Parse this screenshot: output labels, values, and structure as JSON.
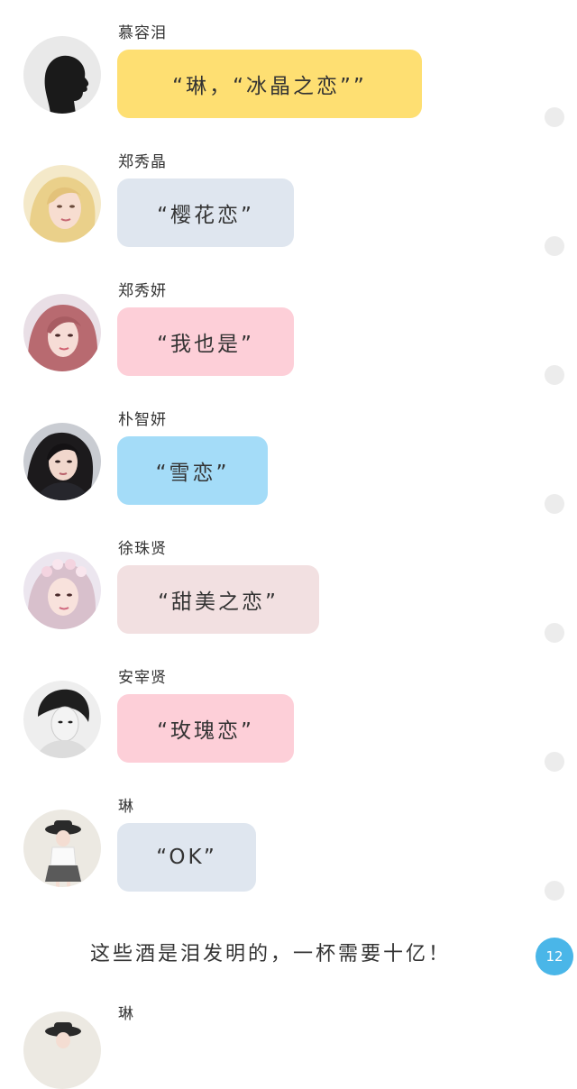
{
  "messages": [
    {
      "sender": "慕容泪",
      "text": "“琳，“冰晶之恋””",
      "bubble_color": "#fedf72",
      "bubble_width": 338
    },
    {
      "sender": "郑秀晶",
      "text": "“樱花恋”",
      "bubble_color": "#dfe6ef",
      "bubble_width": 196
    },
    {
      "sender": "郑秀妍",
      "text": "“我也是”",
      "bubble_color": "#fdcfd8",
      "bubble_width": 196
    },
    {
      "sender": "朴智妍",
      "text": "“雪恋”",
      "bubble_color": "#a4dcf8",
      "bubble_width": 167
    },
    {
      "sender": "徐珠贤",
      "text": "“甜美之恋”",
      "bubble_color": "#f2e0e1",
      "bubble_width": 224
    },
    {
      "sender": "安宰贤",
      "text": "“玫瑰恋”",
      "bubble_color": "#fdcfd8",
      "bubble_width": 196
    },
    {
      "sender": "琳",
      "text": "“OK”",
      "bubble_color": "#dfe6ef",
      "bubble_width": 154
    }
  ],
  "narration": "这些酒是泪发明的，一杯需要十亿！",
  "unread_count": "12",
  "next_sender": "琳"
}
